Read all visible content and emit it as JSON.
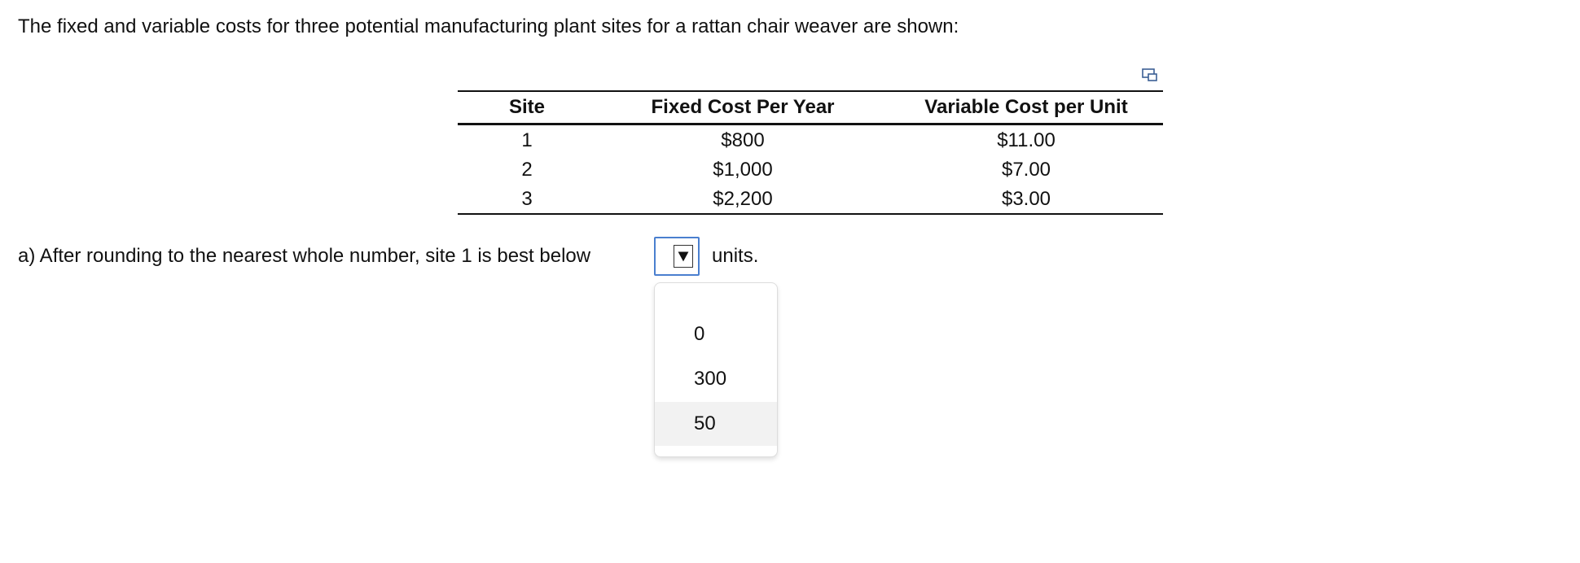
{
  "intro_text": "The fixed and variable costs for three potential manufacturing plant sites for a rattan chair weaver are shown:",
  "table": {
    "headers": [
      "Site",
      "Fixed Cost Per Year",
      "Variable Cost per Unit"
    ],
    "rows": [
      {
        "site": "1",
        "fixed": "$800",
        "variable": "$11.00"
      },
      {
        "site": "2",
        "fixed": "$1,000",
        "variable": "$7.00"
      },
      {
        "site": "3",
        "fixed": "$2,200",
        "variable": "$3.00"
      }
    ]
  },
  "question": {
    "prefix": "a) After rounding to the nearest whole number, site 1 is best below",
    "selected_value": "",
    "suffix": "units.",
    "options": [
      "0",
      "300",
      "50"
    ],
    "highlighted_option": "50"
  },
  "icons": {
    "copy": "copy-table-icon",
    "dropdown_arrow": "triangle-down-icon"
  },
  "colors": {
    "select_border": "#4a7fcf",
    "option_hover": "#f2f2f2"
  }
}
